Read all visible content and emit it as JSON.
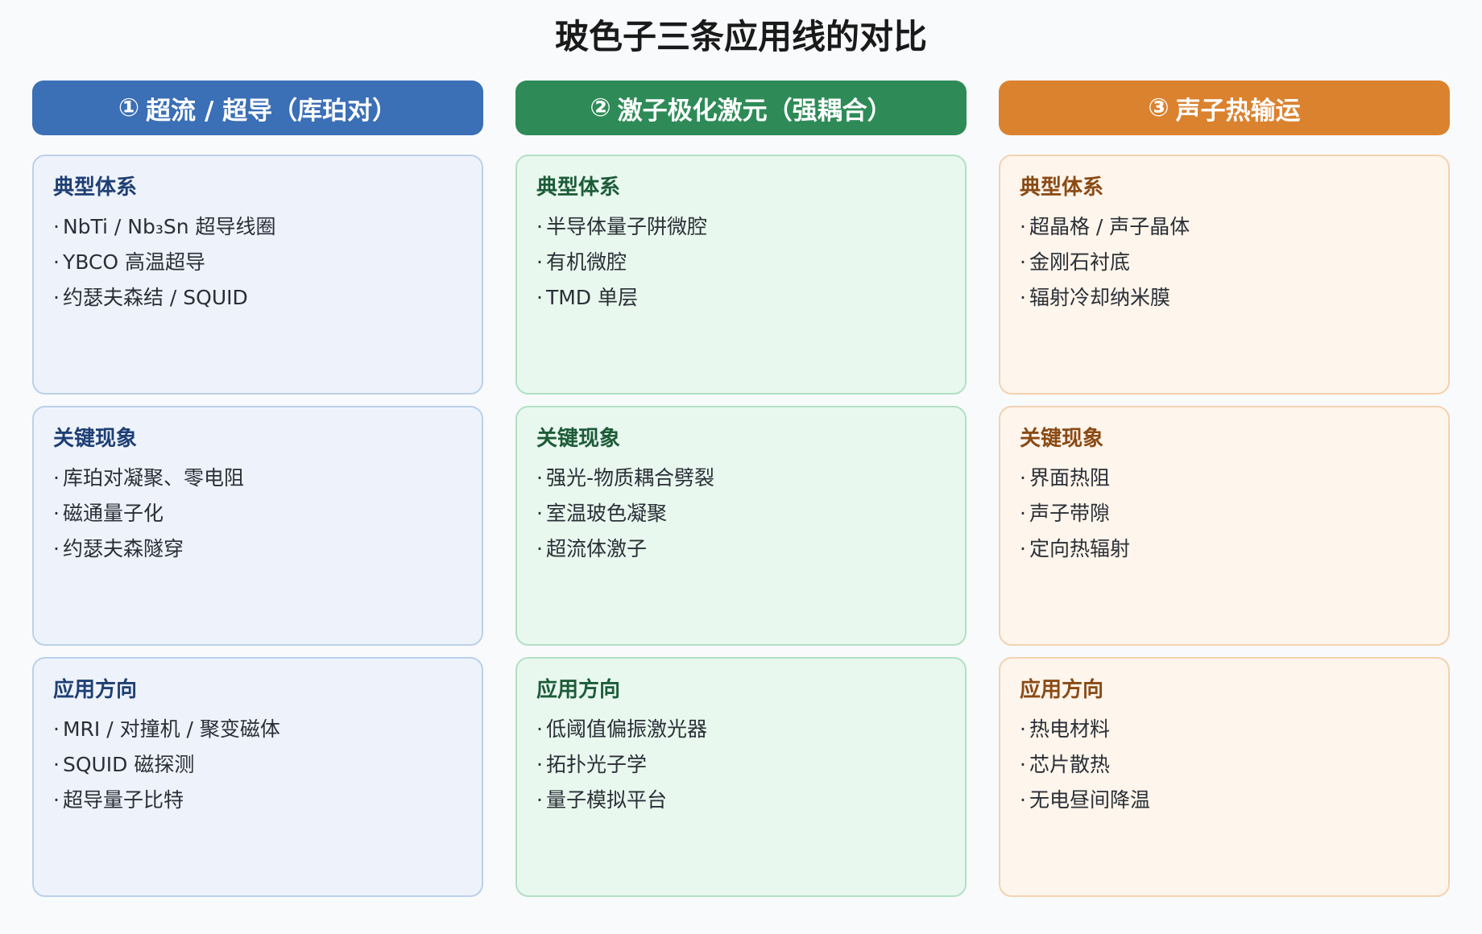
{
  "title": "玻色子三条应用线的对比",
  "columns": [
    {
      "num": "①",
      "header": "超流 / 超导（库珀对）",
      "cards": [
        {
          "title": "典型体系",
          "items": [
            "NbTi / Nb₃Sn 超导线圈",
            "YBCO 高温超导",
            "约瑟夫森结 / SQUID"
          ]
        },
        {
          "title": "关键现象",
          "items": [
            "库珀对凝聚、零电阻",
            "磁通量子化",
            "约瑟夫森隧穿"
          ]
        },
        {
          "title": "应用方向",
          "items": [
            "MRI / 对撞机 / 聚变磁体",
            "SQUID 磁探测",
            "超导量子比特"
          ]
        }
      ]
    },
    {
      "num": "②",
      "header": "激子极化激元（强耦合）",
      "cards": [
        {
          "title": "典型体系",
          "items": [
            "半导体量子阱微腔",
            "有机微腔",
            "TMD 单层"
          ]
        },
        {
          "title": "关键现象",
          "items": [
            "强光-物质耦合劈裂",
            "室温玻色凝聚",
            "超流体激子"
          ]
        },
        {
          "title": "应用方向",
          "items": [
            "低阈值偏振激光器",
            "拓扑光子学",
            "量子模拟平台"
          ]
        }
      ]
    },
    {
      "num": "③",
      "header": "声子热输运",
      "cards": [
        {
          "title": "典型体系",
          "items": [
            "超晶格 / 声子晶体",
            "金刚石衬底",
            "辐射冷却纳米膜"
          ]
        },
        {
          "title": "关键现象",
          "items": [
            "界面热阻",
            "声子带隙",
            "定向热辐射"
          ]
        },
        {
          "title": "应用方向",
          "items": [
            "热电材料",
            "芯片散热",
            "无电昼间降温"
          ]
        }
      ]
    }
  ],
  "colors": {
    "col1_accent": "#3b6fb6",
    "col2_accent": "#2e8b57",
    "col3_accent": "#db822f"
  },
  "bullet": "·"
}
